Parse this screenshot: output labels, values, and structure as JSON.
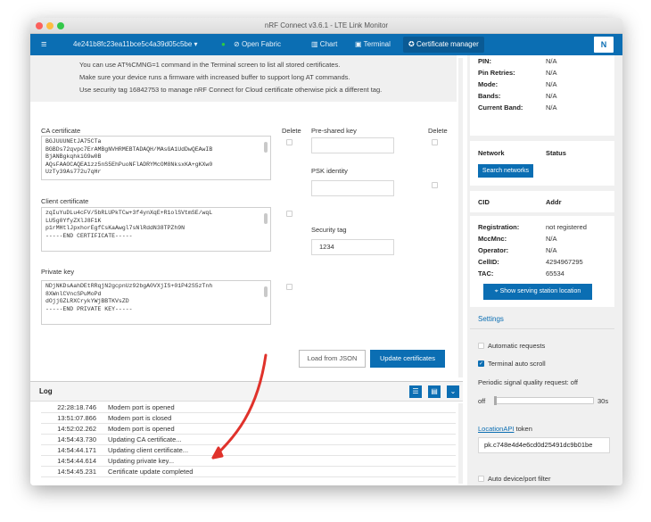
{
  "window": {
    "title": "nRF Connect v3.6.1 - LTE Link Monitor"
  },
  "appbar": {
    "menu_icon": "menu-icon",
    "device": "4e241b8fc23ea11bce5c4a39d05c5be",
    "open_button": "Open Fabric",
    "chart_tab": "Chart",
    "terminal_tab": "Terminal",
    "cert_tab": "Certificate manager",
    "logo_icon": "nordic-logo-icon"
  },
  "notice": {
    "line1": "You can use AT%CMNG=1 command in the Terminal screen to list all stored certificates.",
    "line2": "Make sure your device runs a firmware with increased buffer to support long AT commands.",
    "line3": "Use security tag 16842753 to manage nRF Connect for Cloud certificate otherwise pick a different tag."
  },
  "cert": {
    "ca_label": "CA certificate",
    "ca_text": "BGJUUUNEtJA75CTa\nBGBDs72qvpc7ErAMBgNVHRMEBTADAQH/MAsGA1UdDwQEAwIB\nBjANBgkqhkiG9w0B\nAQsFAAOCAQEA1zz5nS5EhPuoNFlADRYMcOM8NksxKA+gKXw0\nUzTy39As772u7qHr",
    "ca_delete_label": "Delete",
    "client_label": "Client certificate",
    "client_text": "zqIuYuDLu4cFV/5bRLUPkTCw+3f4ynXqE+R1olSVtmSE/wqL\nLU5g0YfyZXlJ8F1K\np1rMHtlJpxhorEgfCsKaAwgl7sNlRddN38TPZh9N\n-----END CERTIFICATE-----",
    "private_label": "Private key",
    "private_text": "NDjNKDsAahDEtRRqjN2gcpnUz92bgA0VXjIS+01P42S5zTnh\n8XWnlCVncSPuMoPd\ndOjjGZLRXCrykYWjBBTKVsZD\n-----END PRIVATE KEY-----",
    "psk_label": "Pre-shared key",
    "psk_delete_label": "Delete",
    "pskid_label": "PSK identity",
    "tag_label": "Security tag",
    "tag_value": "1234",
    "load_button": "Load from JSON",
    "update_button": "Update certificates"
  },
  "log": {
    "title": "Log",
    "rows": [
      {
        "time": "22:28:18.746",
        "msg": "Modem port is opened"
      },
      {
        "time": "13:51:07.866",
        "msg": "Modem port is closed"
      },
      {
        "time": "14:52:02.262",
        "msg": "Modem port is opened"
      },
      {
        "time": "14:54:43.730",
        "msg": "Updating CA certificate..."
      },
      {
        "time": "14:54:44.171",
        "msg": "Updating client certificate..."
      },
      {
        "time": "14:54:44.614",
        "msg": "Updating private key..."
      },
      {
        "time": "14:54:45.231",
        "msg": "Certificate update completed"
      }
    ]
  },
  "side": {
    "top": [
      {
        "k": "PIN:",
        "v": "N/A"
      },
      {
        "k": "Pin Retries:",
        "v": "N/A"
      },
      {
        "k": "Mode:",
        "v": "N/A"
      },
      {
        "k": "Bands:",
        "v": "N/A"
      },
      {
        "k": "Current Band:",
        "v": "N/A"
      }
    ],
    "network_label": "Network",
    "status_label": "Status",
    "search_button": "Search networks",
    "cid_label": "CID",
    "addr_label": "Addr",
    "reg": [
      {
        "k": "Registration:",
        "v": "not registered"
      },
      {
        "k": "MccMnc:",
        "v": "N/A"
      },
      {
        "k": "Operator:",
        "v": "N/A"
      },
      {
        "k": "CellID:",
        "v": "4294967295"
      },
      {
        "k": "TAC:",
        "v": "65534"
      }
    ],
    "location_button": "Show serving station location",
    "settings_title": "Settings",
    "auto_requests": "Automatic requests",
    "auto_scroll": "Terminal auto scroll",
    "periodic_label": "Periodic signal quality request: off",
    "slider_off": "off",
    "slider_max": "30s",
    "location_api": "LocationAPI",
    "token_label": " token",
    "token_value": "pk.c748e4d4e6cd0d25491dc9b01be",
    "auto_filter": "Auto device/port filter"
  }
}
